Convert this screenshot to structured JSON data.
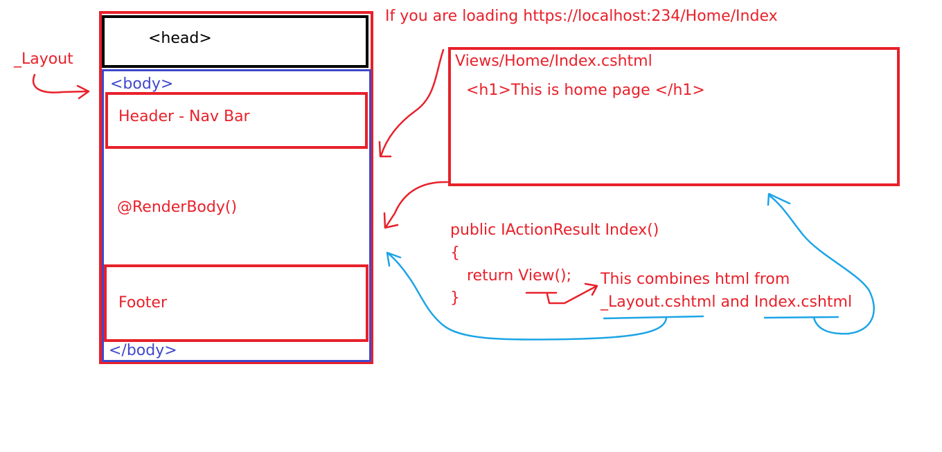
{
  "layout": {
    "label": "_Layout",
    "head": "<head>",
    "body_open": "<body>",
    "header": "Header - Nav Bar",
    "render_body": "@RenderBody()",
    "footer": "Footer",
    "body_close": "</body>"
  },
  "url_note": "If you are loading https://localhost:234/Home/Index",
  "view": {
    "path": "Views/Home/Index.cshtml",
    "content": "<h1>This is home page </h1>"
  },
  "controller": {
    "line1": "public IActionResult Index()",
    "line2": "{",
    "line3": "return View();",
    "line4": "}"
  },
  "note": {
    "line1": "This combines html from",
    "line2": "_Layout.cshtml and Index.cshtml"
  },
  "colors": {
    "red": "#e8202a",
    "blue": "#3f48cc",
    "cyan": "#1ca4e6",
    "black": "#000000"
  }
}
